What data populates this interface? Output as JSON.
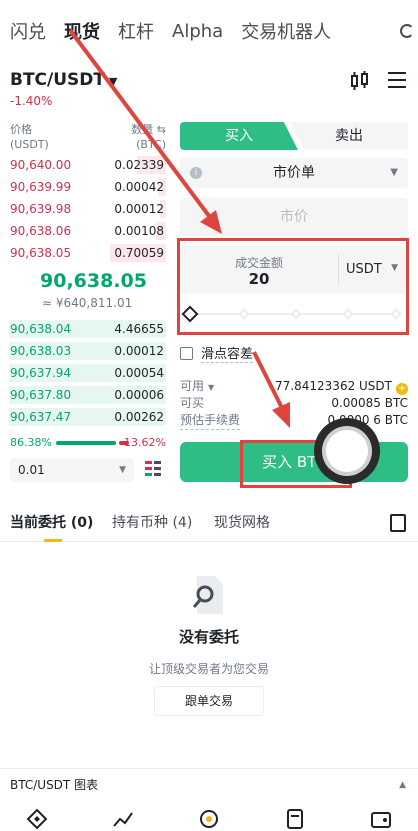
{
  "top_tabs": [
    "闪兑",
    "现货",
    "杠杆",
    "Alpha",
    "交易机器人"
  ],
  "pair": {
    "name": "BTC/USDT",
    "change": "-1.40%"
  },
  "orderbook": {
    "price_header": "价格\n(USDT)",
    "qty_header": "数量 ⇆\n(BTC)",
    "asks": [
      {
        "price": "90,640.00",
        "qty": "0.02339",
        "depth": 0.18
      },
      {
        "price": "90,639.99",
        "qty": "0.00042",
        "depth": 0.05
      },
      {
        "price": "90,639.98",
        "qty": "0.00012",
        "depth": 0.04
      },
      {
        "price": "90,638.06",
        "qty": "0.00108",
        "depth": 0.06
      },
      {
        "price": "90,638.05",
        "qty": "0.70059",
        "depth": 0.35
      }
    ],
    "last_price": "90,638.05",
    "cny_price": "≈ ¥640,811.01",
    "bids": [
      {
        "price": "90,638.04",
        "qty": "4.46655",
        "depth": 0.98
      },
      {
        "price": "90,638.03",
        "qty": "0.00012",
        "depth": 0.98
      },
      {
        "price": "90,637.94",
        "qty": "0.00054",
        "depth": 0.98
      },
      {
        "price": "90,637.80",
        "qty": "0.00006",
        "depth": 0.98
      },
      {
        "price": "90,637.47",
        "qty": "0.00262",
        "depth": 0.98
      }
    ],
    "buy_ratio": "86.38%",
    "sell_ratio": "13.62%",
    "precision": "0.01"
  },
  "trade": {
    "buy_tab": "买入",
    "sell_tab": "卖出",
    "order_type": "市价单",
    "price_placeholder": "市价",
    "amount_label": "成交金额",
    "amount_value": "20",
    "amount_unit": "USDT",
    "slippage": "滑点容差",
    "available_label": "可用",
    "available_value": "77.84123362 USDT",
    "can_buy_label": "可买",
    "can_buy_value": "0.00085 BTC",
    "fee_label": "预估手续费",
    "fee_value": "0.0000 6 BTC",
    "buy_button": "买入 BTC"
  },
  "sections": {
    "open_orders": "当前委托 (0)",
    "holdings": "持有币种 (4)",
    "grid": "现货网格"
  },
  "empty": {
    "title": "没有委托",
    "subtitle": "让顶级交易者为您交易",
    "button": "跟单交易"
  },
  "chart_bar": "BTC/USDT 图表",
  "colors": {
    "buy": "#2ebd85",
    "sell": "#cf304a",
    "highlight": "#e0443e",
    "brand": "#f0b90b"
  }
}
